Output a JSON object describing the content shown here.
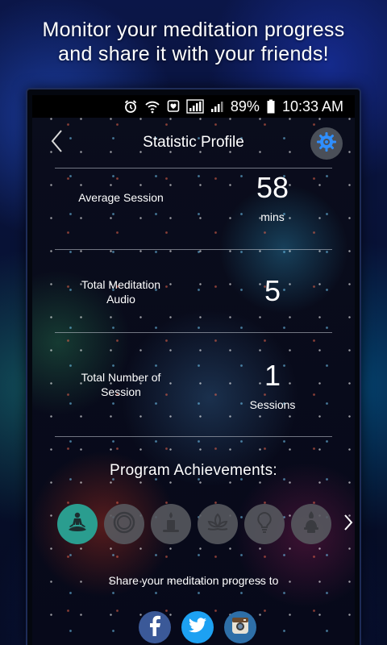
{
  "promo": {
    "line1": "Monitor your meditation progress",
    "line2": "and share it with your friends!"
  },
  "status_bar": {
    "battery": "89%",
    "time": "10:33 AM",
    "icons": [
      "alarm-icon",
      "wifi-icon",
      "notification-icon",
      "signal-icon",
      "signal-icon",
      "battery-icon"
    ]
  },
  "header": {
    "title": "Statistic Profile",
    "back_icon": "chevron-left-icon",
    "settings_icon": "gear-icon"
  },
  "stats": [
    {
      "label_lines": [
        "Average Session"
      ],
      "value": "58",
      "unit": "mins"
    },
    {
      "label_lines": [
        "Total Meditation",
        "Audio"
      ],
      "value": "5",
      "unit": ""
    },
    {
      "label_lines": [
        "Total Number of",
        "Session"
      ],
      "value": "1",
      "unit": "Sessions"
    }
  ],
  "achievements": {
    "title": "Program Achievements:",
    "items": [
      {
        "icon": "meditation-figure-icon",
        "unlocked": true
      },
      {
        "icon": "singing-bowl-icon",
        "unlocked": false
      },
      {
        "icon": "candle-icon",
        "unlocked": false
      },
      {
        "icon": "lotus-icon",
        "unlocked": false
      },
      {
        "icon": "lightbulb-icon",
        "unlocked": false
      },
      {
        "icon": "incense-icon",
        "unlocked": false
      }
    ],
    "next_icon": "chevron-right-icon"
  },
  "share": {
    "label": "Share your meditation progress to",
    "networks": [
      {
        "icon": "facebook-icon",
        "color": "#3b5998"
      },
      {
        "icon": "twitter-icon",
        "color": "#1da1f2"
      },
      {
        "icon": "instagram-icon",
        "color": "#2e6fa8"
      }
    ]
  },
  "colors": {
    "accent": "#2a9d8f",
    "locked_badge": "#58595f",
    "settings_button": "#4a4f58",
    "settings_gear": "#2f8fff"
  }
}
